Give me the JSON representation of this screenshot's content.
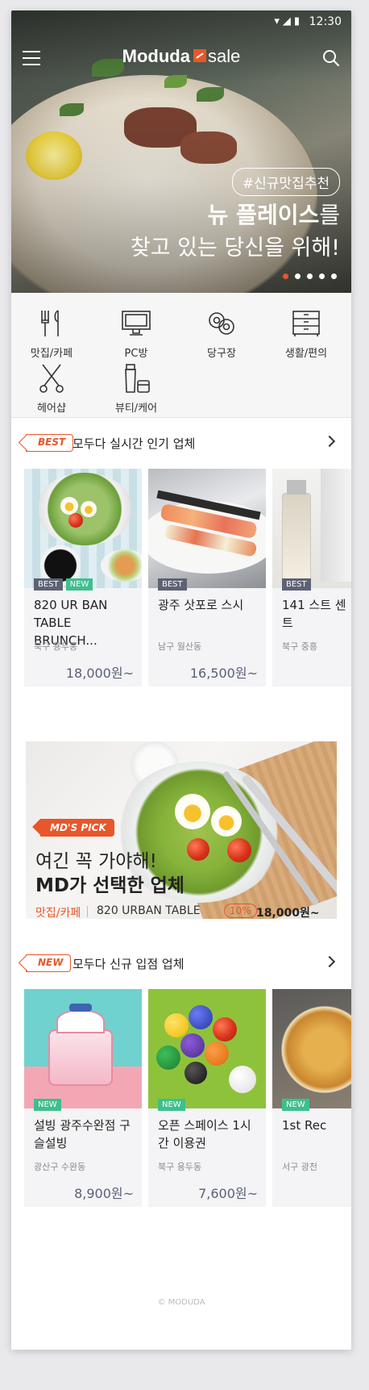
{
  "status": {
    "time": "12:30",
    "icons": [
      "wifi-icon",
      "signal-icon",
      "battery-icon"
    ]
  },
  "header": {
    "logo_main": "Moduda",
    "logo_sub": "sale"
  },
  "hero": {
    "tag": "#신규맛집추천",
    "line1_bold": "뉴 플레이스",
    "line1_rest": "를",
    "line2": "찾고 있는 당신을 위해!",
    "slides": 5,
    "active_slide": 1
  },
  "categories": [
    {
      "label": "맛집/카페",
      "icon": "utensils-icon"
    },
    {
      "label": "PC방",
      "icon": "monitor-icon"
    },
    {
      "label": "당구장",
      "icon": "billiard-icon"
    },
    {
      "label": "생활/편의",
      "icon": "drawer-icon"
    },
    {
      "label": "헤어샵",
      "icon": "scissors-icon"
    },
    {
      "label": "뷰티/케어",
      "icon": "cosmetics-icon"
    }
  ],
  "best_section": {
    "tag": "BEST",
    "title": "모두다 실시간 인기 업체",
    "items": [
      {
        "badges": [
          "BEST",
          "NEW"
        ],
        "name": "820 UR BAN TABLE BRUNCH...",
        "location": "북구 용두동",
        "price": "18,000원~"
      },
      {
        "badges": [
          "BEST"
        ],
        "name": "광주 삿포로 스시",
        "location": "남구 월산동",
        "price": "16,500원~"
      },
      {
        "badges": [
          "BEST"
        ],
        "name": "141 스트 센트",
        "location": "북구 중흥",
        "price": ""
      }
    ]
  },
  "md_pick": {
    "tag": "MD'S PICK",
    "line1": "여긴 꼭 가야해!",
    "line2": "MD가 선택한 업체",
    "category": "맛집/카페",
    "name": "820 URBAN TABLE",
    "discount": "10%",
    "price": "18,000원~"
  },
  "new_section": {
    "tag": "NEW",
    "title": "모두다 신규 입점 업체",
    "items": [
      {
        "badges": [
          "NEW"
        ],
        "name": "설빙 광주수완점 구슬설빙",
        "location": "광산구 수완동",
        "price": "8,900원~"
      },
      {
        "badges": [
          "NEW"
        ],
        "name": "오픈 스페이스 1시간 이용권",
        "location": "북구 용두동",
        "price": "7,600원~"
      },
      {
        "badges": [
          "NEW"
        ],
        "name": "1st Rec",
        "location": "서구 광천",
        "price": ""
      }
    ]
  },
  "footer": {
    "copyright": "© MODUDA"
  },
  "colors": {
    "accent": "#e8562a",
    "badge_best": "#5e6275",
    "badge_new": "#3ebf8e",
    "price": "#5a5f78"
  }
}
